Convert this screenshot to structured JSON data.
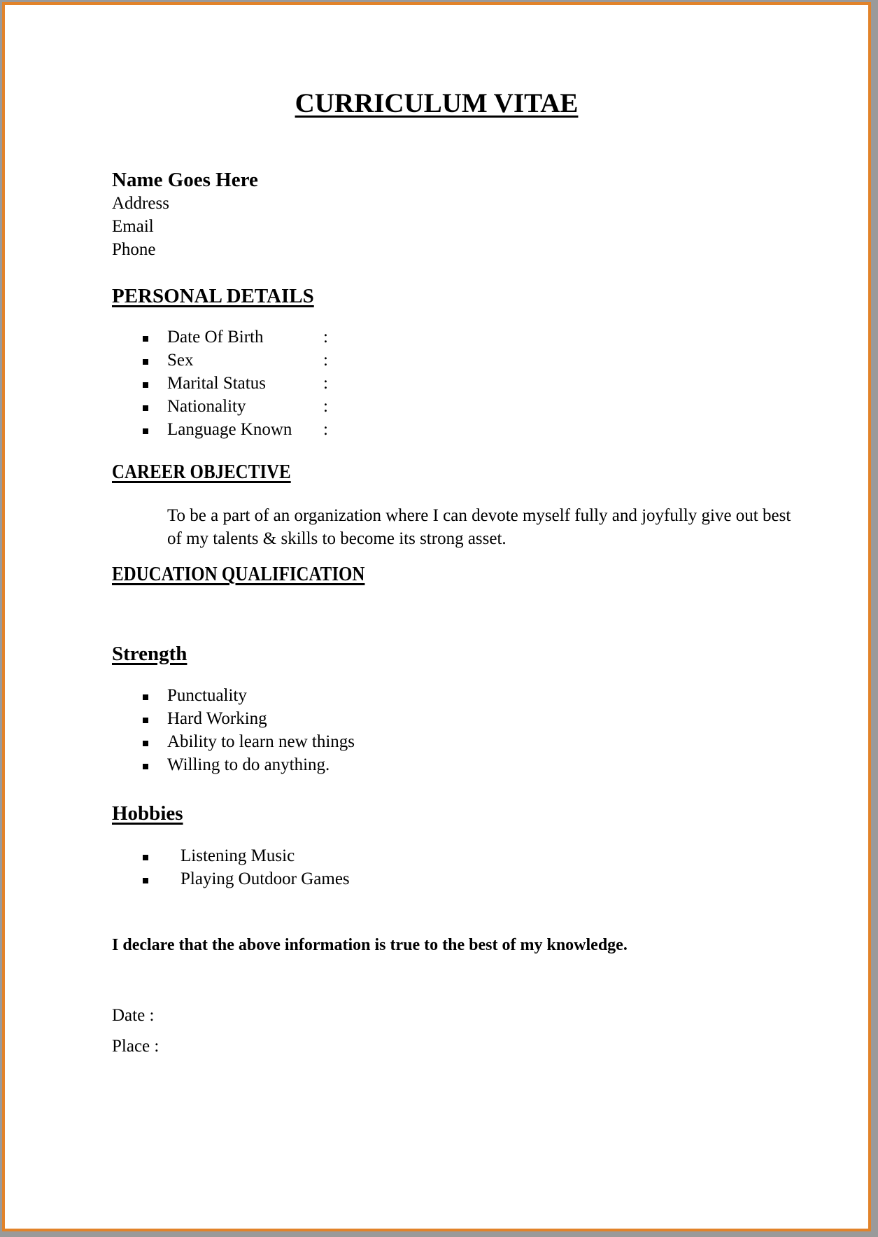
{
  "document": {
    "title": "CURRICULUM VITAE",
    "name": "Name Goes Here",
    "contact": [
      "Address",
      "Email",
      "Phone"
    ],
    "personal_details": {
      "heading": "PERSONAL DETAILS",
      "items": [
        {
          "label": "Date Of Birth",
          "separator": ":"
        },
        {
          "label": "Sex",
          "separator": ":"
        },
        {
          "label": "Marital Status",
          "separator": ":"
        },
        {
          "label": "Nationality",
          "separator": ":"
        },
        {
          "label": "Language Known",
          "separator": ":"
        }
      ]
    },
    "career_objective": {
      "heading": "CAREER OBJECTIVE",
      "text": "To be a part of an organization where I can devote myself fully and joyfully give out best of my talents & skills to become its strong asset."
    },
    "education": {
      "heading": "EDUCATION QUALIFICATION"
    },
    "strength": {
      "heading": "Strength",
      "items": [
        "Punctuality",
        "Hard Working",
        "Ability to learn new things",
        "Willing to do anything."
      ]
    },
    "hobbies": {
      "heading": "Hobbies",
      "items": [
        "Listening Music",
        "Playing Outdoor Games"
      ]
    },
    "declaration": "I declare that the above information is true to the best of my knowledge.",
    "signature": {
      "date_label": "Date  :",
      "place_label": "Place :"
    }
  },
  "colors": {
    "page_border": "#e2832a",
    "backdrop": "#9a9a9a"
  }
}
